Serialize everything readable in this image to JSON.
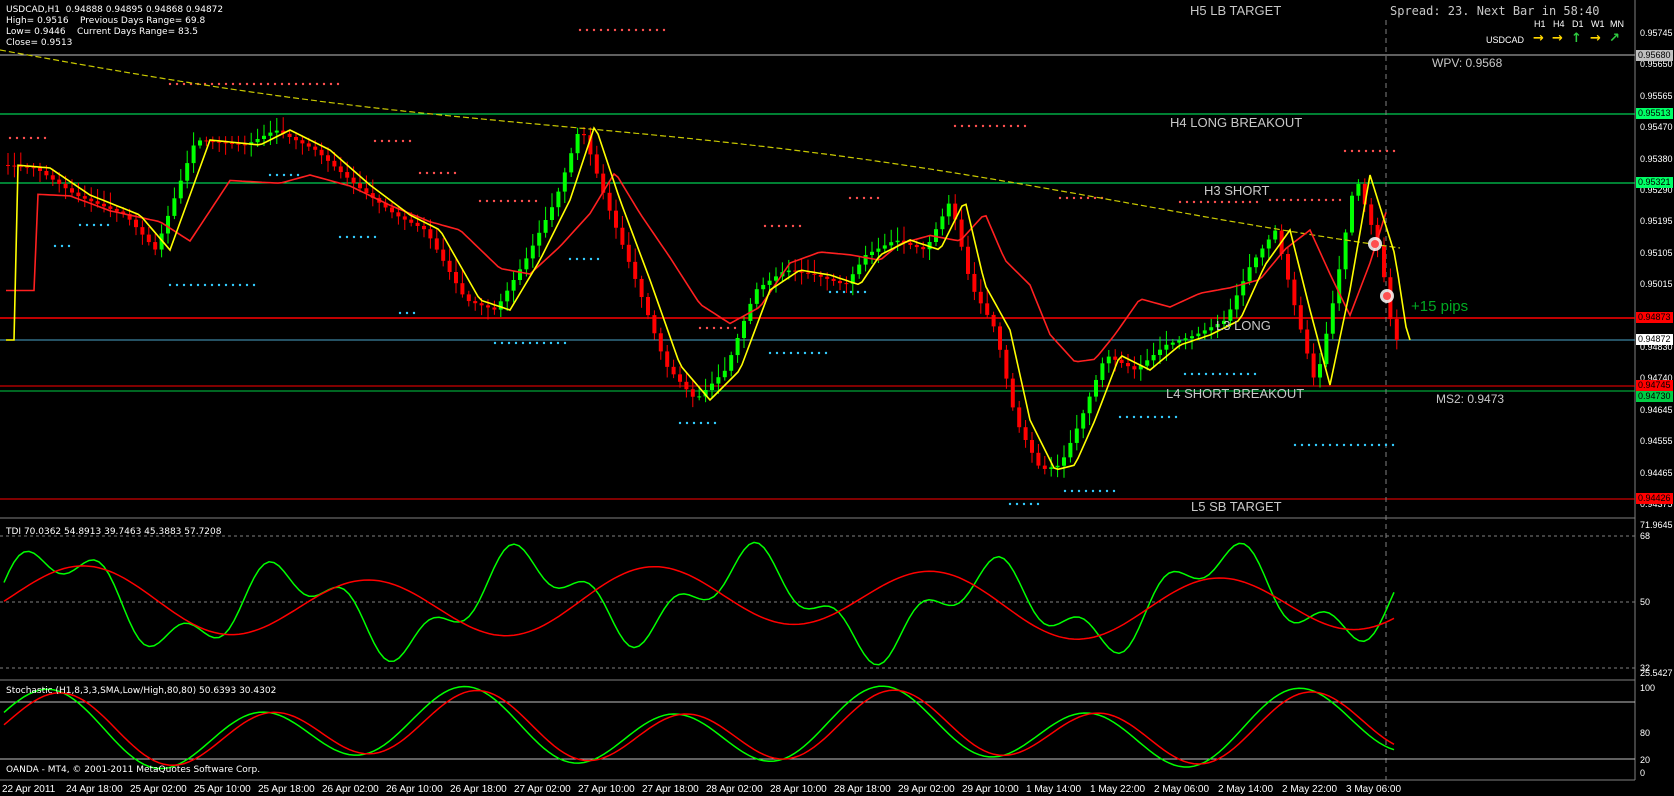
{
  "header": {
    "symbol_line": "USDCAD,H1  0.94888 0.94895 0.94868 0.94872",
    "high_line": "High= 0.9516    Previous Days Range= 69.8",
    "low_line": "Low= 0.9446    Current Days Range= 83.5",
    "close_line": "Close= 0.9513"
  },
  "spread_text": "Spread: 23. Next Bar in 58:40",
  "timeframes": {
    "symbol": "USDCAD",
    "labels": [
      "H1",
      "H4",
      "D1",
      "W1",
      "MN"
    ],
    "arrow_colors": [
      "#ffd700",
      "#ffd700",
      "#2ecc40",
      "#ffd700",
      "#2ecc40"
    ]
  },
  "levels": {
    "h5": "H5 LB TARGET",
    "h4": "H4 LONG BREAKOUT",
    "h3": "H3 SHORT",
    "l3": "L3 LONG",
    "l4": "L4 SHORT BREAKOUT",
    "l5": "L5 SB TARGET",
    "wpv": "WPV:  0.9568",
    "ms2": "MS2:  0.9473",
    "pips": "+15 pips"
  },
  "price_axis": [
    "0.95745",
    "0.95650",
    "0.95565",
    "0.95470",
    "0.95380",
    "0.95290",
    "0.95195",
    "0.95105",
    "0.95015",
    "0.94920",
    "0.94830",
    "0.94740",
    "0.94645",
    "0.94555",
    "0.94465",
    "0.94375"
  ],
  "price_boxes": {
    "wpv": "0.95680",
    "h4": "0.95513",
    "h3": "0.95321",
    "cur_red": "0.94873",
    "cur": "0.94872",
    "l4": "0.94745",
    "l4b": "0.94730",
    "l5": "0.94426"
  },
  "tdi": {
    "label": "TDI 70.0362 54.8913 39.7463 45.3883 57.7208",
    "axis": [
      "71.9645",
      "68",
      "50",
      "32",
      "25.5427"
    ]
  },
  "stoch": {
    "label": "Stochastic (H1,8,3,3,SMA,Low/High,80,80) 50.6393 30.4302",
    "axis": [
      "100",
      "80",
      "20",
      "0"
    ]
  },
  "copyright": "OANDA - MT4, © 2001-2011 MetaQuotes Software Corp.",
  "time_axis": [
    "22 Apr 2011",
    "24 Apr 18:00",
    "25 Apr 02:00",
    "25 Apr 10:00",
    "25 Apr 18:00",
    "26 Apr 02:00",
    "26 Apr 10:00",
    "26 Apr 18:00",
    "27 Apr 02:00",
    "27 Apr 10:00",
    "27 Apr 18:00",
    "28 Apr 02:00",
    "28 Apr 10:00",
    "28 Apr 18:00",
    "29 Apr 02:00",
    "29 Apr 10:00",
    "1 May 14:00",
    "1 May 22:00",
    "2 May 06:00",
    "2 May 14:00",
    "2 May 22:00",
    "3 May 06:00"
  ],
  "colors": {
    "bull": "#00ff00",
    "bear": "#ff0000",
    "fast_ma": "#ffff00",
    "slow_ma": "#ff2020",
    "long_ma": "#c8c800",
    "pivot_green": "#00ff66",
    "pivot_red": "#ff0000",
    "blue_dots": "#33ccff",
    "red_dots": "#ff5050",
    "pane_border": "#808080"
  }
}
